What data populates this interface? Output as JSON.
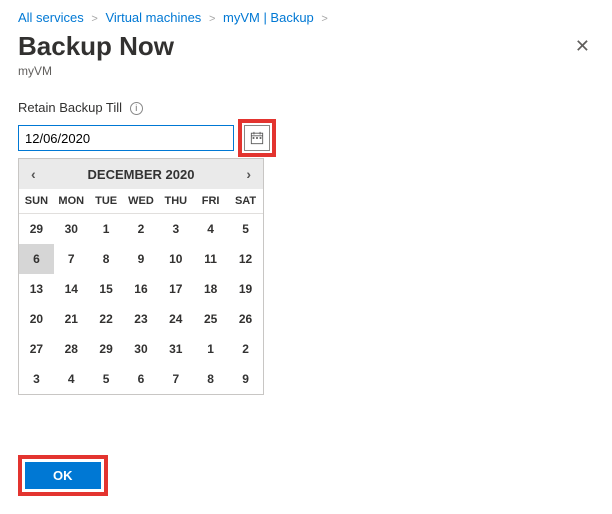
{
  "breadcrumb": {
    "items": [
      "All services",
      "Virtual machines",
      "myVM | Backup"
    ]
  },
  "header": {
    "title": "Backup Now",
    "subtitle": "myVM"
  },
  "field": {
    "label": "Retain Backup Till",
    "value": "12/06/2020"
  },
  "calendar": {
    "month_label": "DECEMBER 2020",
    "dow": [
      "SUN",
      "MON",
      "TUE",
      "WED",
      "THU",
      "FRI",
      "SAT"
    ],
    "rows": [
      [
        {
          "d": "29",
          "o": true
        },
        {
          "d": "30",
          "o": true
        },
        {
          "d": "1"
        },
        {
          "d": "2"
        },
        {
          "d": "3"
        },
        {
          "d": "4"
        },
        {
          "d": "5"
        }
      ],
      [
        {
          "d": "6",
          "sel": true
        },
        {
          "d": "7"
        },
        {
          "d": "8"
        },
        {
          "d": "9"
        },
        {
          "d": "10"
        },
        {
          "d": "11"
        },
        {
          "d": "12"
        }
      ],
      [
        {
          "d": "13"
        },
        {
          "d": "14"
        },
        {
          "d": "15"
        },
        {
          "d": "16"
        },
        {
          "d": "17"
        },
        {
          "d": "18"
        },
        {
          "d": "19"
        }
      ],
      [
        {
          "d": "20"
        },
        {
          "d": "21"
        },
        {
          "d": "22"
        },
        {
          "d": "23"
        },
        {
          "d": "24"
        },
        {
          "d": "25"
        },
        {
          "d": "26"
        }
      ],
      [
        {
          "d": "27"
        },
        {
          "d": "28"
        },
        {
          "d": "29"
        },
        {
          "d": "30"
        },
        {
          "d": "31"
        },
        {
          "d": "1",
          "o": true
        },
        {
          "d": "2",
          "o": true
        }
      ],
      [
        {
          "d": "3",
          "o": true
        },
        {
          "d": "4",
          "o": true
        },
        {
          "d": "5",
          "o": true
        },
        {
          "d": "6",
          "o": true
        },
        {
          "d": "7",
          "o": true
        },
        {
          "d": "8",
          "o": true
        },
        {
          "d": "9",
          "o": true
        }
      ]
    ]
  },
  "footer": {
    "ok_label": "OK"
  }
}
